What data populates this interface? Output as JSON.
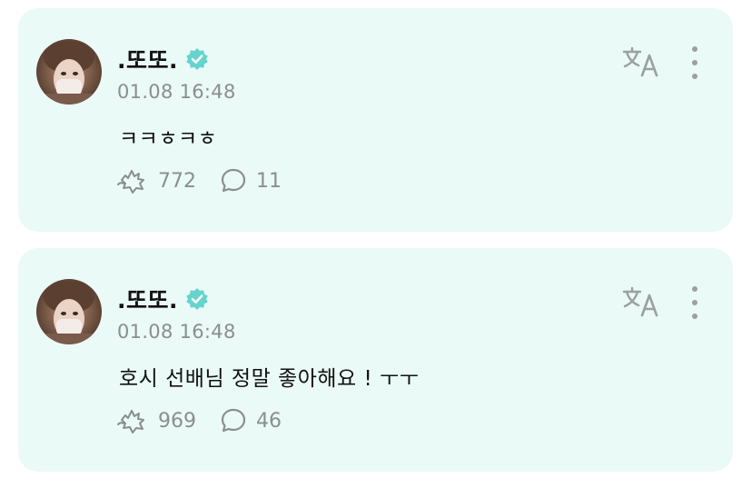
{
  "posts": [
    {
      "username": ".또또.",
      "timestamp": "01.08 16:48",
      "text": "ㅋㅋㅎㅋㅎ",
      "likes": "772",
      "comments": "11"
    },
    {
      "username": ".또또.",
      "timestamp": "01.08 16:48",
      "text": "호시 선배님 정말 좋아해요 ! ㅜㅜ",
      "likes": "969",
      "comments": "46"
    }
  ],
  "icons": {
    "verified": "verified-badge-icon",
    "translate": "translate-icon",
    "more": "more-vertical-icon",
    "like": "like-sticker-icon",
    "comment": "comment-bubble-icon"
  },
  "colors": {
    "card_background": "#eafaf6",
    "verified_badge": "#66d3cd",
    "muted_text": "#8a8f8e"
  }
}
